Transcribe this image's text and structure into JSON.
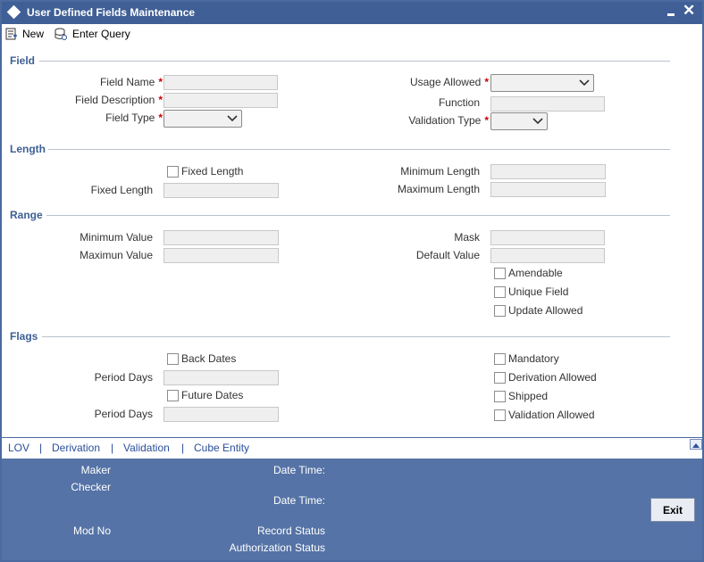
{
  "window": {
    "title": "User Defined Fields Maintenance"
  },
  "toolbar": {
    "new_label": "New",
    "enter_query_label": "Enter Query"
  },
  "sections": {
    "field": "Field",
    "length": "Length",
    "range": "Range",
    "flags": "Flags"
  },
  "field": {
    "field_name_label": "Field Name",
    "field_description_label": "Field Description",
    "field_type_label": "Field Type",
    "usage_allowed_label": "Usage Allowed",
    "function_label": "Function",
    "validation_type_label": "Validation Type",
    "required_mark": "*"
  },
  "length": {
    "fixed_length_checkbox": "Fixed Length",
    "fixed_length_label": "Fixed Length",
    "minimum_length_label": "Minimum Length",
    "maximum_length_label": "Maximum Length"
  },
  "range": {
    "minimum_value_label": "Minimum Value",
    "maximum_value_label": "Maximun Value",
    "mask_label": "Mask",
    "default_value_label": "Default Value",
    "amendable": "Amendable",
    "unique_field": "Unique Field",
    "update_allowed": "Update Allowed"
  },
  "flags": {
    "back_dates": "Back Dates",
    "period_days_1": "Period Days",
    "future_dates": "Future Dates",
    "period_days_2": "Period Days",
    "mandatory": "Mandatory",
    "derivation_allowed": "Derivation Allowed",
    "shipped": "Shipped",
    "validation_allowed": "Validation Allowed"
  },
  "links": {
    "lov": "LOV",
    "derivation": "Derivation",
    "validation": "Validation",
    "cube_entity": "Cube Entity",
    "separator": "|"
  },
  "footer": {
    "maker": "Maker",
    "checker": "Checker",
    "date_time_1": "Date Time:",
    "date_time_2": "Date Time:",
    "mod_no": "Mod No",
    "record_status": "Record Status",
    "authorization_status": "Authorization Status",
    "exit_label": "Exit"
  },
  "colors": {
    "title_bar": "#3f5f96",
    "section_label": "#3d5f94",
    "footer": "#5573a6",
    "required": "#cc0000",
    "link": "#2a4f9a"
  },
  "icons": [
    "minimize-icon",
    "close-icon",
    "new-document-icon",
    "enter-query-icon",
    "chevron-down-icon",
    "scroll-up-icon"
  ]
}
